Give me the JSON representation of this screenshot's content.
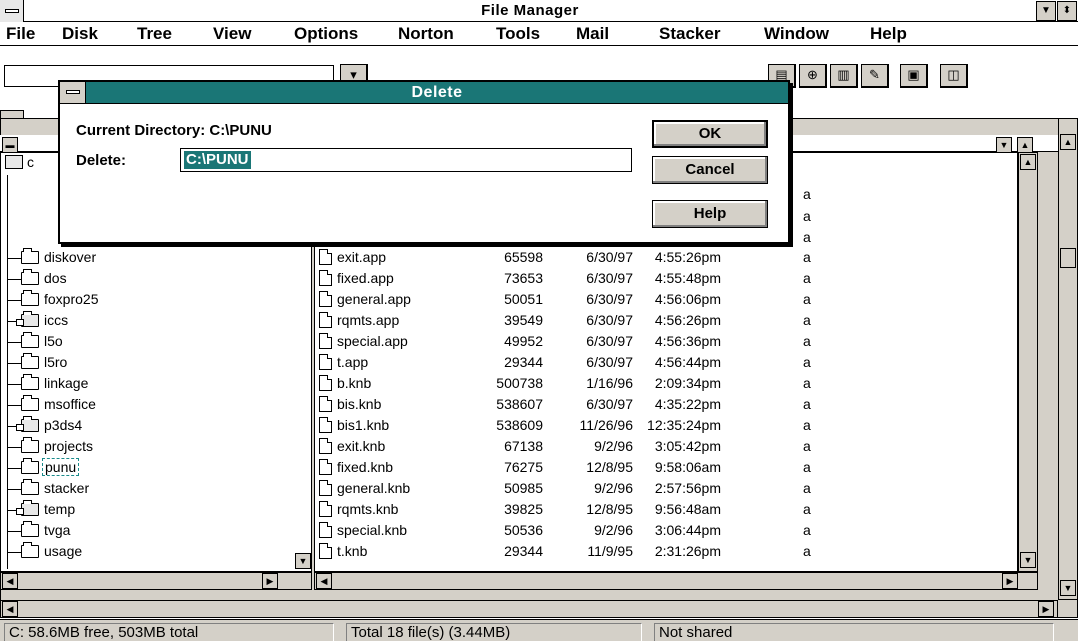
{
  "app": {
    "title": "File Manager"
  },
  "menu": [
    "File",
    "Disk",
    "Tree",
    "View",
    "Options",
    "Norton",
    "Tools",
    "Mail",
    "Stacker",
    "Window",
    "Help"
  ],
  "toolbar": {
    "drive_combo_value": ""
  },
  "tree": {
    "items": [
      {
        "label": "diskover"
      },
      {
        "label": "dos"
      },
      {
        "label": "foxpro25"
      },
      {
        "label": "iccs"
      },
      {
        "label": "l5o"
      },
      {
        "label": "l5ro"
      },
      {
        "label": "linkage"
      },
      {
        "label": "msoffice"
      },
      {
        "label": "p3ds4"
      },
      {
        "label": "projects"
      },
      {
        "label": "punu"
      },
      {
        "label": "stacker"
      },
      {
        "label": "temp"
      },
      {
        "label": "tvga"
      },
      {
        "label": "usage"
      }
    ]
  },
  "files": {
    "hidden_attrs": [
      "a",
      "a",
      "a"
    ],
    "rows": [
      {
        "name": "exit.app",
        "size": "65598",
        "date": "6/30/97",
        "time": "4:55:26pm",
        "attr": "a"
      },
      {
        "name": "fixed.app",
        "size": "73653",
        "date": "6/30/97",
        "time": "4:55:48pm",
        "attr": "a"
      },
      {
        "name": "general.app",
        "size": "50051",
        "date": "6/30/97",
        "time": "4:56:06pm",
        "attr": "a"
      },
      {
        "name": "rqmts.app",
        "size": "39549",
        "date": "6/30/97",
        "time": "4:56:26pm",
        "attr": "a"
      },
      {
        "name": "special.app",
        "size": "49952",
        "date": "6/30/97",
        "time": "4:56:36pm",
        "attr": "a"
      },
      {
        "name": "t.app",
        "size": "29344",
        "date": "6/30/97",
        "time": "4:56:44pm",
        "attr": "a"
      },
      {
        "name": "b.knb",
        "size": "500738",
        "date": "1/16/96",
        "time": "2:09:34pm",
        "attr": "a"
      },
      {
        "name": "bis.knb",
        "size": "538607",
        "date": "6/30/97",
        "time": "4:35:22pm",
        "attr": "a"
      },
      {
        "name": "bis1.knb",
        "size": "538609",
        "date": "11/26/96",
        "time": "12:35:24pm",
        "attr": "a"
      },
      {
        "name": "exit.knb",
        "size": "67138",
        "date": "9/2/96",
        "time": "3:05:42pm",
        "attr": "a"
      },
      {
        "name": "fixed.knb",
        "size": "76275",
        "date": "12/8/95",
        "time": "9:58:06am",
        "attr": "a"
      },
      {
        "name": "general.knb",
        "size": "50985",
        "date": "9/2/96",
        "time": "2:57:56pm",
        "attr": "a"
      },
      {
        "name": "rqmts.knb",
        "size": "39825",
        "date": "12/8/95",
        "time": "9:56:48am",
        "attr": "a"
      },
      {
        "name": "special.knb",
        "size": "50536",
        "date": "9/2/96",
        "time": "3:06:44pm",
        "attr": "a"
      },
      {
        "name": "t.knb",
        "size": "29344",
        "date": "11/9/95",
        "time": "2:31:26pm",
        "attr": "a"
      }
    ]
  },
  "status": {
    "drive": "C: 58.6MB free,  503MB total",
    "total": "Total 18 file(s) (3.44MB)",
    "share": "Not shared"
  },
  "dialog": {
    "title": "Delete",
    "current_dir_label": "Current Directory: C:\\PUNU",
    "delete_label": "Delete:",
    "delete_value": "C:\\PUNU",
    "ok": "OK",
    "cancel": "Cancel",
    "help": "Help"
  },
  "icons": [
    "system-menu-icon",
    "minimize-icon",
    "restore-icon",
    "folder-icon",
    "document-icon",
    "scroll-up-icon",
    "scroll-down-icon",
    "scroll-left-icon",
    "scroll-right-icon"
  ]
}
